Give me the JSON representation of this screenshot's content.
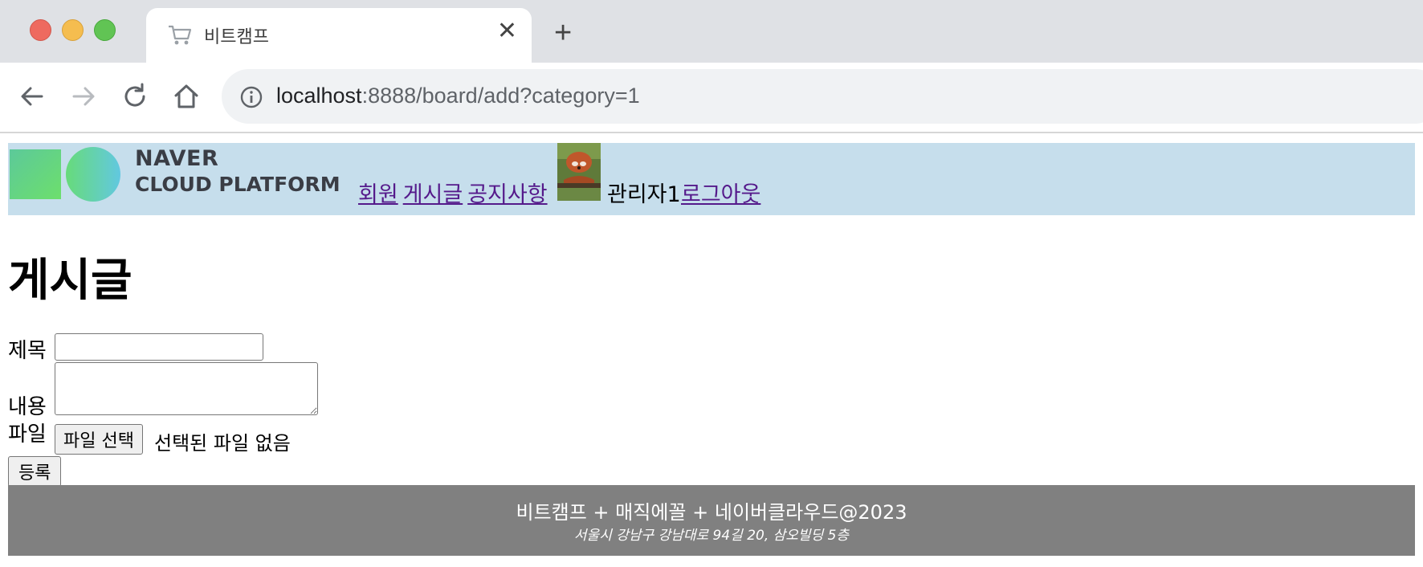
{
  "browser": {
    "tab_title": "비트캠프",
    "close_glyph": "✕",
    "new_tab_glyph": "+",
    "url_host": "localhost",
    "url_rest": ":8888/board/add?category=1"
  },
  "header": {
    "logo_line1": "NAVER",
    "logo_line2": "CLOUD PLATFORM",
    "nav": [
      {
        "label": "회원"
      },
      {
        "label": "게시글"
      },
      {
        "label": "공지사항"
      }
    ],
    "user_name": "관리자1",
    "logout_label": "로그아웃"
  },
  "main": {
    "title": "게시글",
    "form": {
      "title_label": "제목",
      "content_label": "내용",
      "file_label": "파일",
      "file_button": "파일 선택",
      "file_status": "선택된 파일 없음",
      "submit_label": "등록"
    }
  },
  "footer": {
    "line1": "비트캠프 + 매직에꼴 + 네이버클라우드@2023",
    "line2": "서울시 강남구 강남대로 94길 20, 삼오빌딩 5층"
  },
  "colors": {
    "header_bg": "#c6deec",
    "link": "#551a8b",
    "footer_bg": "#808080"
  }
}
